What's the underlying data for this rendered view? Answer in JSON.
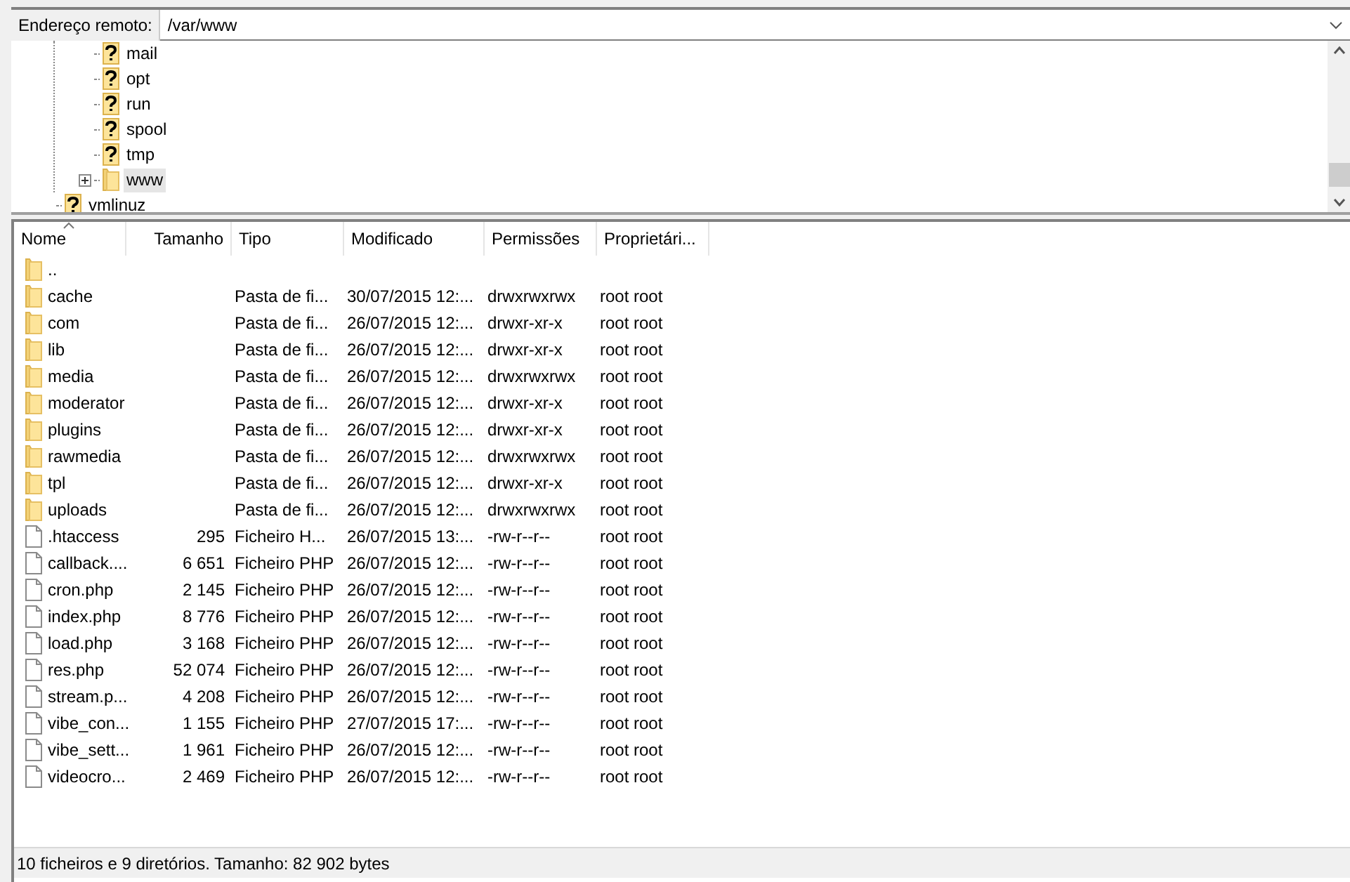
{
  "address_bar": {
    "label": "Endereço remoto:",
    "value": "/var/www"
  },
  "tree": {
    "items": [
      {
        "children": [
          {
            "label": "mail",
            "kind": "unknown",
            "expandable": false,
            "selected": false
          },
          {
            "label": "opt",
            "kind": "unknown",
            "expandable": false,
            "selected": false
          },
          {
            "label": "run",
            "kind": "unknown",
            "expandable": false,
            "selected": false
          },
          {
            "label": "spool",
            "kind": "unknown",
            "expandable": false,
            "selected": false
          },
          {
            "label": "tmp",
            "kind": "unknown",
            "expandable": false,
            "selected": false
          },
          {
            "label": "www",
            "kind": "folder",
            "expandable": true,
            "selected": true
          }
        ]
      },
      {
        "label": "vmlinuz",
        "kind": "unknown",
        "expandable": false,
        "selected": false
      }
    ]
  },
  "file_list": {
    "columns": [
      {
        "label": "Nome",
        "sorted": true
      },
      {
        "label": "Tamanho",
        "sorted": false
      },
      {
        "label": "Tipo",
        "sorted": false
      },
      {
        "label": "Modificado",
        "sorted": false
      },
      {
        "label": "Permissões",
        "sorted": false
      },
      {
        "label": "Proprietári...",
        "sorted": false
      }
    ],
    "rows": [
      {
        "kind": "folder",
        "name": ".."
      },
      {
        "kind": "folder",
        "name": "cache",
        "type": "Pasta de fi...",
        "modified": "30/07/2015 12:...",
        "permissions": "drwxrwxrwx",
        "owner": "root root"
      },
      {
        "kind": "folder",
        "name": "com",
        "type": "Pasta de fi...",
        "modified": "26/07/2015 12:...",
        "permissions": "drwxr-xr-x",
        "owner": "root root"
      },
      {
        "kind": "folder",
        "name": "lib",
        "type": "Pasta de fi...",
        "modified": "26/07/2015 12:...",
        "permissions": "drwxr-xr-x",
        "owner": "root root"
      },
      {
        "kind": "folder",
        "name": "media",
        "type": "Pasta de fi...",
        "modified": "26/07/2015 12:...",
        "permissions": "drwxrwxrwx",
        "owner": "root root"
      },
      {
        "kind": "folder",
        "name": "moderator",
        "type": "Pasta de fi...",
        "modified": "26/07/2015 12:...",
        "permissions": "drwxr-xr-x",
        "owner": "root root"
      },
      {
        "kind": "folder",
        "name": "plugins",
        "type": "Pasta de fi...",
        "modified": "26/07/2015 12:...",
        "permissions": "drwxr-xr-x",
        "owner": "root root"
      },
      {
        "kind": "folder",
        "name": "rawmedia",
        "type": "Pasta de fi...",
        "modified": "26/07/2015 12:...",
        "permissions": "drwxrwxrwx",
        "owner": "root root"
      },
      {
        "kind": "folder",
        "name": "tpl",
        "type": "Pasta de fi...",
        "modified": "26/07/2015 12:...",
        "permissions": "drwxr-xr-x",
        "owner": "root root"
      },
      {
        "kind": "folder",
        "name": "uploads",
        "type": "Pasta de fi...",
        "modified": "26/07/2015 12:...",
        "permissions": "drwxrwxrwx",
        "owner": "root root"
      },
      {
        "kind": "file",
        "name": ".htaccess",
        "size": "295",
        "type": "Ficheiro H...",
        "modified": "26/07/2015 13:...",
        "permissions": "-rw-r--r--",
        "owner": "root root"
      },
      {
        "kind": "file",
        "name": "callback....",
        "size": "6 651",
        "type": "Ficheiro PHP",
        "modified": "26/07/2015 12:...",
        "permissions": "-rw-r--r--",
        "owner": "root root"
      },
      {
        "kind": "file",
        "name": "cron.php",
        "size": "2 145",
        "type": "Ficheiro PHP",
        "modified": "26/07/2015 12:...",
        "permissions": "-rw-r--r--",
        "owner": "root root"
      },
      {
        "kind": "file",
        "name": "index.php",
        "size": "8 776",
        "type": "Ficheiro PHP",
        "modified": "26/07/2015 12:...",
        "permissions": "-rw-r--r--",
        "owner": "root root"
      },
      {
        "kind": "file",
        "name": "load.php",
        "size": "3 168",
        "type": "Ficheiro PHP",
        "modified": "26/07/2015 12:...",
        "permissions": "-rw-r--r--",
        "owner": "root root"
      },
      {
        "kind": "file",
        "name": "res.php",
        "size": "52 074",
        "type": "Ficheiro PHP",
        "modified": "26/07/2015 12:...",
        "permissions": "-rw-r--r--",
        "owner": "root root"
      },
      {
        "kind": "file",
        "name": "stream.p...",
        "size": "4 208",
        "type": "Ficheiro PHP",
        "modified": "26/07/2015 12:...",
        "permissions": "-rw-r--r--",
        "owner": "root root"
      },
      {
        "kind": "file",
        "name": "vibe_con...",
        "size": "1 155",
        "type": "Ficheiro PHP",
        "modified": "27/07/2015 17:...",
        "permissions": "-rw-r--r--",
        "owner": "root root"
      },
      {
        "kind": "file",
        "name": "vibe_sett...",
        "size": "1 961",
        "type": "Ficheiro PHP",
        "modified": "26/07/2015 12:...",
        "permissions": "-rw-r--r--",
        "owner": "root root"
      },
      {
        "kind": "file",
        "name": "videocro...",
        "size": "2 469",
        "type": "Ficheiro PHP",
        "modified": "26/07/2015 12:...",
        "permissions": "-rw-r--r--",
        "owner": "root root"
      }
    ]
  },
  "status_bar": "10 ficheiros e 9 diretórios. Tamanho: 82 902 bytes"
}
